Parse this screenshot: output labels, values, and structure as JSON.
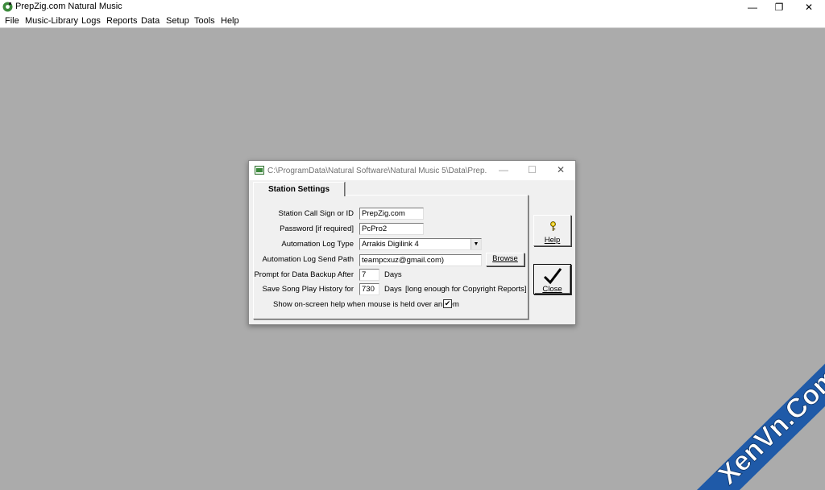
{
  "app": {
    "title": "PrepZig.com Natural Music",
    "controls": {
      "minimize": "—",
      "restore": "❐",
      "close": "✕"
    }
  },
  "menu": [
    "File",
    "Music-Library",
    "Logs",
    "Reports",
    "Data",
    "Setup",
    "Tools",
    "Help"
  ],
  "dialog": {
    "title": "C:\\ProgramData\\Natural Software\\Natural Music 5\\Data\\Prep...",
    "controls": {
      "minimize": "—",
      "maximize": "☐",
      "close": "✕"
    },
    "tab": "Station Settings",
    "fields": {
      "call_sign": {
        "label": "Station Call Sign or ID",
        "value": "PrepZig.com"
      },
      "password": {
        "label": "Password [if required]",
        "value": "PcPro2"
      },
      "log_type": {
        "label": "Automation Log Type",
        "value": "Arrakis Digilink 4"
      },
      "send_path": {
        "label": "Automation Log Send Path",
        "value": "teampcxuz@gmail.com)"
      },
      "backup": {
        "label": "Prompt for Data Backup After",
        "value": "7",
        "unit": "Days"
      },
      "history": {
        "label": "Save Song Play History for",
        "value": "730",
        "unit": "Days",
        "note": "[long enough for Copyright Reports]"
      },
      "help_tips": {
        "label": "Show on-screen help when mouse is held over an item",
        "checked": true
      }
    },
    "buttons": {
      "browse": "Browse",
      "help": "Help",
      "close": "Close"
    }
  },
  "watermark": "XenVn.Com",
  "colors": {
    "workspace": "#ababab",
    "dialog": "#f0f0f0",
    "watermark": "#1f5aa8"
  }
}
